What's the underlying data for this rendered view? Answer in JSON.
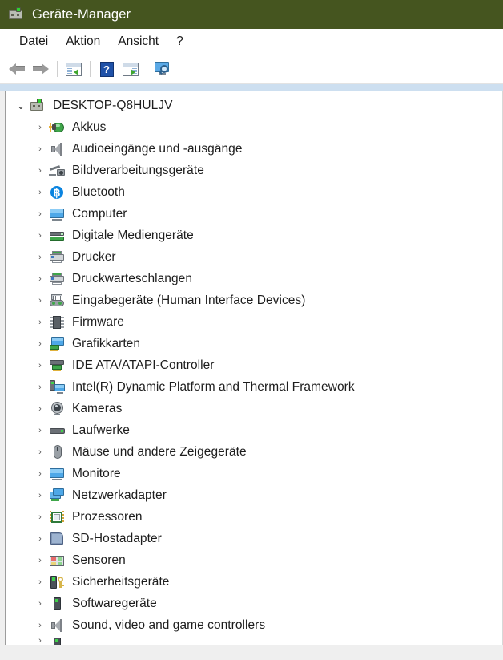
{
  "window": {
    "title": "Geräte-Manager",
    "title_icon": "device-manager-icon",
    "titlebar_color": "#45551f"
  },
  "menubar": {
    "items": [
      {
        "label": "Datei",
        "name": "menu-datei"
      },
      {
        "label": "Aktion",
        "name": "menu-aktion"
      },
      {
        "label": "Ansicht",
        "name": "menu-ansicht"
      },
      {
        "label": "?",
        "name": "menu-hilfe"
      }
    ]
  },
  "toolbar": {
    "buttons": [
      {
        "name": "back-button",
        "icon": "back-arrow-icon",
        "label": ""
      },
      {
        "name": "forward-button",
        "icon": "forward-arrow-icon",
        "label": ""
      },
      {
        "name": "show-hide-console-tree-button",
        "icon": "console-tree-back-icon",
        "label": ""
      },
      {
        "name": "help-button",
        "icon": "help-question-icon",
        "label": "?"
      },
      {
        "name": "show-hide-action-pane-button",
        "icon": "console-tree-forward-icon",
        "label": ""
      },
      {
        "name": "scan-for-hardware-changes-button",
        "icon": "scan-monitor-icon",
        "label": ""
      }
    ]
  },
  "tree": {
    "root": {
      "label": "DESKTOP-Q8HULJV",
      "icon": "computer-icon",
      "expanded": true,
      "chevron": "⌄"
    },
    "chevron_collapsed": "›",
    "children": [
      {
        "label": "Akkus",
        "icon": "battery-icon",
        "icon_class": "i-bat"
      },
      {
        "label": "Audioeingänge und -ausgänge",
        "icon": "speaker-icon",
        "icon_class": "i-spk"
      },
      {
        "label": "Bildverarbeitungsgeräte",
        "icon": "imaging-device-icon",
        "icon_class": "i-img"
      },
      {
        "label": "Bluetooth",
        "icon": "bluetooth-icon",
        "icon_class": "i-bt"
      },
      {
        "label": "Computer",
        "icon": "monitor-icon",
        "icon_class": "i-mon"
      },
      {
        "label": "Digitale Mediengeräte",
        "icon": "media-device-icon",
        "icon_class": "i-media"
      },
      {
        "label": "Drucker",
        "icon": "printer-icon",
        "icon_class": "i-prn"
      },
      {
        "label": "Druckwarteschlangen",
        "icon": "print-queue-icon",
        "icon_class": "i-prn"
      },
      {
        "label": "Eingabegeräte (Human Interface Devices)",
        "icon": "hid-input-icon",
        "icon_class": "i-hid"
      },
      {
        "label": "Firmware",
        "icon": "chip-icon",
        "icon_class": "i-chip"
      },
      {
        "label": "Grafikkarten",
        "icon": "display-adapter-icon",
        "icon_class": "i-gfx"
      },
      {
        "label": "IDE ATA/ATAPI-Controller",
        "icon": "ide-controller-icon",
        "icon_class": "i-ide"
      },
      {
        "label": "Intel(R) Dynamic Platform and Thermal Framework",
        "icon": "system-device-icon",
        "icon_class": "i-int"
      },
      {
        "label": "Kameras",
        "icon": "camera-icon",
        "icon_class": "i-cam"
      },
      {
        "label": "Laufwerke",
        "icon": "disk-drive-icon",
        "icon_class": "i-drv"
      },
      {
        "label": "Mäuse und andere Zeigegeräte",
        "icon": "mouse-icon",
        "icon_class": "i-ms"
      },
      {
        "label": "Monitore",
        "icon": "monitor-icon",
        "icon_class": "i-mon"
      },
      {
        "label": "Netzwerkadapter",
        "icon": "network-adapter-icon",
        "icon_class": "i-net"
      },
      {
        "label": "Prozessoren",
        "icon": "processor-icon",
        "icon_class": "i-cpu"
      },
      {
        "label": "SD-Hostadapter",
        "icon": "sd-host-adapter-icon",
        "icon_class": "i-sd"
      },
      {
        "label": "Sensoren",
        "icon": "sensor-icon",
        "icon_class": "i-sen"
      },
      {
        "label": "Sicherheitsgeräte",
        "icon": "security-device-icon",
        "icon_class": "i-sec"
      },
      {
        "label": "Softwaregeräte",
        "icon": "software-device-icon",
        "icon_class": "i-sw"
      },
      {
        "label": "Sound, video and game controllers",
        "icon": "speaker-icon",
        "icon_class": "i-spk"
      }
    ]
  }
}
